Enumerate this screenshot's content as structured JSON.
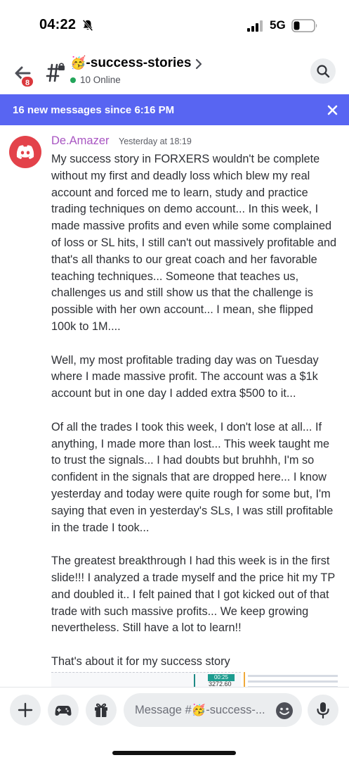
{
  "status_bar": {
    "time": "04:22",
    "network": "5G",
    "icons": [
      "bell-slash-icon",
      "signal-icon",
      "battery-icon"
    ]
  },
  "header": {
    "back_badge": "8",
    "channel_emoji": "🥳",
    "channel_name": "-success-stories",
    "online_text": "10 Online",
    "icons": [
      "back-arrow-icon",
      "locked-hash-icon",
      "chevron-right-icon",
      "search-icon"
    ]
  },
  "banner": {
    "text": "16 new messages since 6:16 PM",
    "close_icon": "close-icon"
  },
  "message": {
    "author": "De.Amazer",
    "timestamp": "Yesterday at 18:19",
    "paragraphs": [
      "My success story in FORXERS wouldn't be complete without my first and deadly loss which blew my real account and forced me to learn, study and practice trading techniques on demo account... In this week, I made massive profits and even while some complained of loss or SL hits, I still can't out massively profitable and that's all thanks to our great coach and her favorable teaching techniques... Someone that teaches us, challenges us and still show us that the challenge is possible with her own account... I mean, she flipped 100k to 1M....",
      "Well, my most profitable trading day was on Tuesday where I made massive profit. The account was a $1k account but in one day I added extra $500 to it...",
      "Of all the trades I took this week, I don't lose at all... If anything, I made more than lost... This week taught me to trust the signals... I had doubts but bruhhh, I'm so confident in the signals that are dropped here... I know yesterday and today were quite rough for some but, I'm saying that even in yesterday's SLs, I was still profitable in the trade I took...",
      "The greatest breakthrough I had this week is in the first slide!!! I analyzed a trade myself and the price hit my TP and doubled it.. I felt pained that I got kicked out of that trade with such massive profits... We keep growing nevertheless. Still have a lot to learn!!",
      "That's about it for my success story"
    ],
    "attachment_1": {
      "tag": "00:25",
      "price": "3272.60"
    }
  },
  "composer": {
    "placeholder": "Message #🥳-success-...",
    "icons": [
      "plus-icon",
      "gamepad-icon",
      "gift-icon",
      "emoji-icon",
      "microphone-icon"
    ]
  },
  "colors": {
    "blurple": "#5865f2",
    "author": "#a855c2",
    "online": "#23a55a",
    "badge": "#da373c",
    "avatar": "#e3424a"
  }
}
